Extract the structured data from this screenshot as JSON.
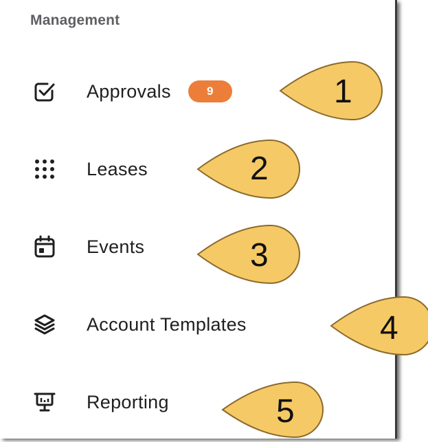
{
  "sidebar": {
    "section_title": "Management",
    "items": [
      {
        "label": "Approvals",
        "icon": "checkbox-icon",
        "badge": "9"
      },
      {
        "label": "Leases",
        "icon": "grid-dots-icon"
      },
      {
        "label": "Events",
        "icon": "calendar-icon"
      },
      {
        "label": "Account Templates",
        "icon": "layers-icon"
      },
      {
        "label": "Reporting",
        "icon": "presentation-chart-icon"
      }
    ]
  },
  "callouts": [
    "1",
    "2",
    "3",
    "4",
    "5"
  ],
  "colors": {
    "badge": "#ec7e3a",
    "callout_fill": "#f6c967",
    "callout_stroke": "#8a6a2a",
    "section_title": "#5f5f63",
    "label": "#1f1f22"
  }
}
